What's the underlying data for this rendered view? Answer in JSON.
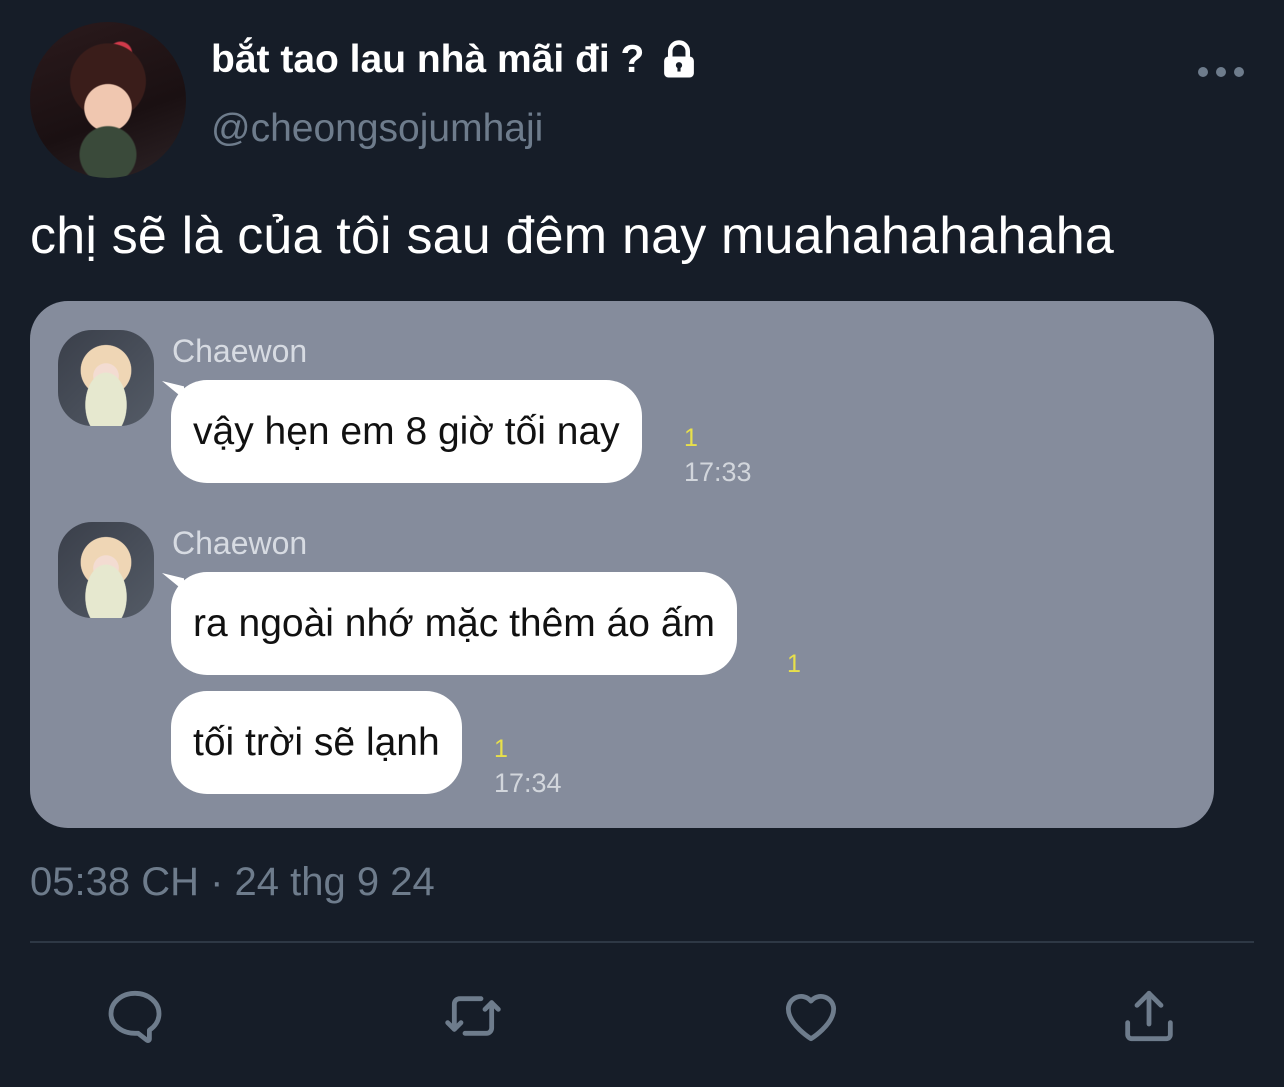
{
  "profile": {
    "display_name": "bắt tao lau nhà mãi đi ?",
    "handle": "@cheongsojumhaji",
    "protected_icon": "lock-icon",
    "menu_icon": "more-horizontal-icon"
  },
  "tweet": {
    "text": "chị sẽ là của tôi sau đêm nay muahahahahaha",
    "timestamp": "05:38 CH · 24 thg 9 24"
  },
  "chat": {
    "groups": [
      {
        "sender": "Chaewon",
        "messages": [
          {
            "text": "vậy hẹn em 8 giờ tối nay",
            "unread": "1",
            "time": "17:33"
          }
        ]
      },
      {
        "sender": "Chaewon",
        "messages": [
          {
            "text": "ra ngoài nhớ mặc thêm áo ấm",
            "unread": "1",
            "time": ""
          },
          {
            "text": "tối trời sẽ lạnh",
            "unread": "1",
            "time": "17:34"
          }
        ]
      }
    ]
  },
  "actions": [
    {
      "name": "reply",
      "icon": "reply-icon"
    },
    {
      "name": "retweet",
      "icon": "retweet-icon"
    },
    {
      "name": "like",
      "icon": "heart-icon"
    },
    {
      "name": "share",
      "icon": "share-icon"
    }
  ],
  "colors": {
    "background": "#161d28",
    "secondary_text": "#6e7c8c",
    "media_background": "#858c9c",
    "unread_badge": "#e8e04a"
  }
}
